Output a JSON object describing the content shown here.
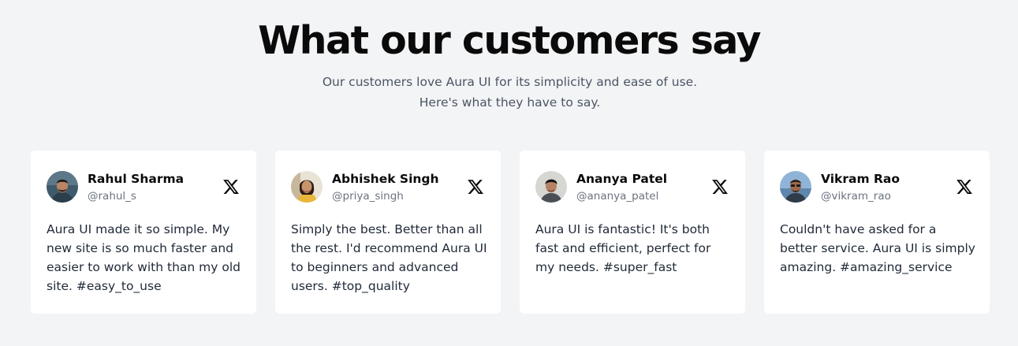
{
  "section": {
    "title": "What our customers say",
    "subtitle": "Our customers love Aura UI for its simplicity and ease of use. Here's what they have to say."
  },
  "testimonials": [
    {
      "name": "Rahul Sharma",
      "handle": "@rahul_s",
      "quote": "Aura UI made it so simple. My new site is so much faster and easier to work with than my old site. #easy_to_use",
      "platform_icon": "x-logo-icon"
    },
    {
      "name": "Abhishek Singh",
      "handle": "@priya_singh",
      "quote": "Simply the best. Better than all the rest. I'd recommend Aura UI to beginners and advanced users. #top_quality",
      "platform_icon": "x-logo-icon"
    },
    {
      "name": "Ananya Patel",
      "handle": "@ananya_patel",
      "quote": "Aura UI is fantastic! It's both fast and efficient, perfect for my needs. #super_fast",
      "platform_icon": "x-logo-icon"
    },
    {
      "name": "Vikram Rao",
      "handle": "@vikram_rao",
      "quote": "Couldn't have asked for a better service. Aura UI is simply amazing. #amazing_service",
      "platform_icon": "x-logo-icon"
    }
  ],
  "colors": {
    "background": "#f3f4f6",
    "card": "#ffffff",
    "heading": "#0a0a0a",
    "muted_text": "#6b7280"
  }
}
